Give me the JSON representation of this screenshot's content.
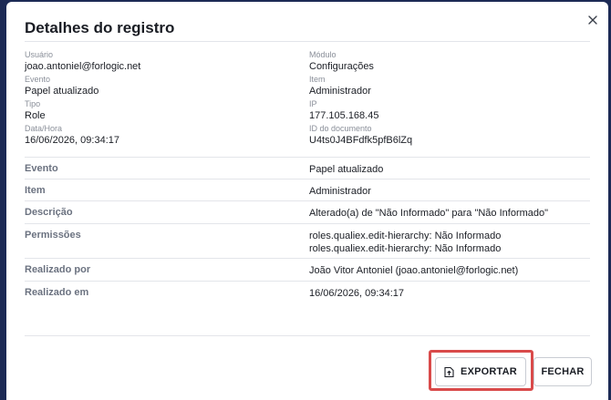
{
  "modal": {
    "title": "Detalhes do registro"
  },
  "meta": {
    "left": [
      {
        "label": "Usuário",
        "value": "joao.antoniel@forlogic.net"
      },
      {
        "label": "Evento",
        "value": "Papel atualizado"
      },
      {
        "label": "Tipo",
        "value": "Role"
      },
      {
        "label": "Data/Hora",
        "value": "16/06/2026, 09:34:17"
      }
    ],
    "right": [
      {
        "label": "Módulo",
        "value": "Configurações"
      },
      {
        "label": "Item",
        "value": "Administrador"
      },
      {
        "label": "IP",
        "value": "177.105.168.45"
      },
      {
        "label": "ID do documento",
        "value": "U4ts0J4BFdfk5pfB6lZq"
      }
    ]
  },
  "details": {
    "evento": {
      "label": "Evento",
      "value": "Papel atualizado"
    },
    "item": {
      "label": "Item",
      "value": "Administrador"
    },
    "descricao": {
      "label": "Descrição",
      "value": "Alterado(a) de \"Não Informado\" para \"Não Informado\""
    },
    "permissoes": {
      "label": "Permissões",
      "values": [
        "roles.qualiex.edit-hierarchy: Não Informado",
        "roles.qualiex.edit-hierarchy: Não Informado"
      ]
    },
    "realizado_por": {
      "label": "Realizado por",
      "value": "João Vitor Antoniel (joao.antoniel@forlogic.net)"
    },
    "realizado_em": {
      "label": "Realizado em",
      "value": "16/06/2026, 09:34:17"
    }
  },
  "buttons": {
    "export_label": "EXPORTAR",
    "close_label": "FECHAR"
  },
  "icons": {
    "close": "close-icon",
    "export": "file-export-icon"
  },
  "colors": {
    "highlight": "#d94a4a",
    "backdrop": "#1c2a55"
  }
}
